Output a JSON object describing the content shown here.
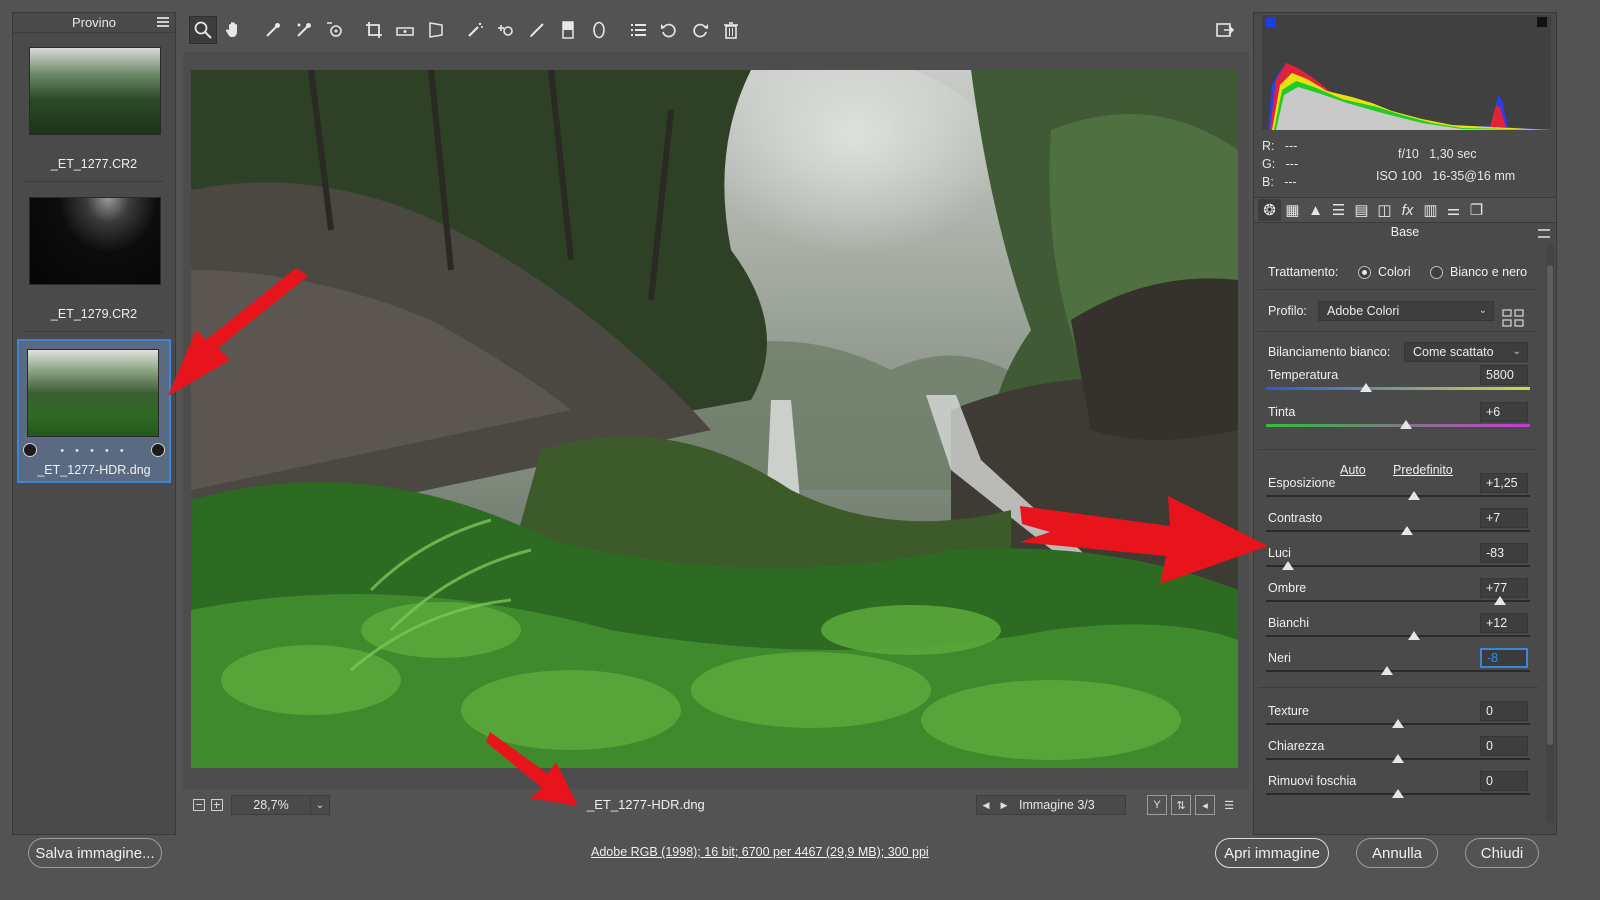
{
  "filmstrip": {
    "title": "Provino",
    "items": [
      {
        "name": "_ET_1277.CR2",
        "selected": false
      },
      {
        "name": "_ET_1279.CR2",
        "selected": false
      },
      {
        "name": "_ET_1277-HDR.dng",
        "selected": true,
        "dots": "• • • • •"
      }
    ]
  },
  "toolbar": {
    "tools": [
      "zoom-tool",
      "hand-tool",
      "white-balance-tool",
      "color-sampler-tool",
      "targeted-adjustment-tool",
      "crop-tool",
      "straighten-tool",
      "transform-tool",
      "spot-removal-tool",
      "red-eye-tool",
      "adjustment-brush-tool",
      "graduated-filter-tool",
      "radial-filter-tool",
      "preferences-icon",
      "rotate-left-icon",
      "rotate-right-icon",
      "trash-icon"
    ],
    "active_tool": "zoom-tool"
  },
  "status": {
    "zoom": "28,7%",
    "filename": "_ET_1277-HDR.dng",
    "image_counter": "Immagine 3/3"
  },
  "info": {
    "r_label": "R:",
    "r_value": "---",
    "g_label": "G:",
    "g_value": "---",
    "b_label": "B:",
    "b_value": "---",
    "aperture": "f/10",
    "shutter": "1,30 sec",
    "iso": "ISO 100",
    "lens": "16-35@16 mm"
  },
  "panel": {
    "title": "Base",
    "treatment_label": "Trattamento:",
    "treatment_options": [
      "Colori",
      "Bianco e nero"
    ],
    "treatment_selected": "Colori",
    "profile_label": "Profilo:",
    "profile_value": "Adobe Colori",
    "wb_label": "Bilanciamento bianco:",
    "wb_value": "Come scattato",
    "auto_link": "Auto",
    "default_link": "Predefinito",
    "sliders": [
      {
        "label": "Temperatura",
        "value": "5800",
        "pos": 0.38
      },
      {
        "label": "Tinta",
        "value": "+6",
        "pos": 0.53
      },
      {
        "label": "Esposizione",
        "value": "+1,25",
        "pos": 0.56
      },
      {
        "label": "Contrasto",
        "value": "+7",
        "pos": 0.535
      },
      {
        "label": "Luci",
        "value": "-83",
        "pos": 0.085
      },
      {
        "label": "Ombre",
        "value": "+77",
        "pos": 0.885
      },
      {
        "label": "Bianchi",
        "value": "+12",
        "pos": 0.56
      },
      {
        "label": "Neri",
        "value": "-8",
        "pos": 0.46
      },
      {
        "label": "Texture",
        "value": "0",
        "pos": 0.5
      },
      {
        "label": "Chiarezza",
        "value": "0",
        "pos": 0.5
      },
      {
        "label": "Rimuovi foschia",
        "value": "0",
        "pos": 0.5
      }
    ]
  },
  "bottom": {
    "save_label": "Salva immagine...",
    "info_link": "Adobe RGB (1998); 16 bit; 6700 per 4467 (29,9 MB); 300 ppi",
    "open_label": "Apri immagine",
    "cancel_label": "Annulla",
    "close_label": "Chiudi"
  },
  "colors": {
    "accent": "#3a86d8",
    "annotation_arrow": "#e8141c"
  }
}
